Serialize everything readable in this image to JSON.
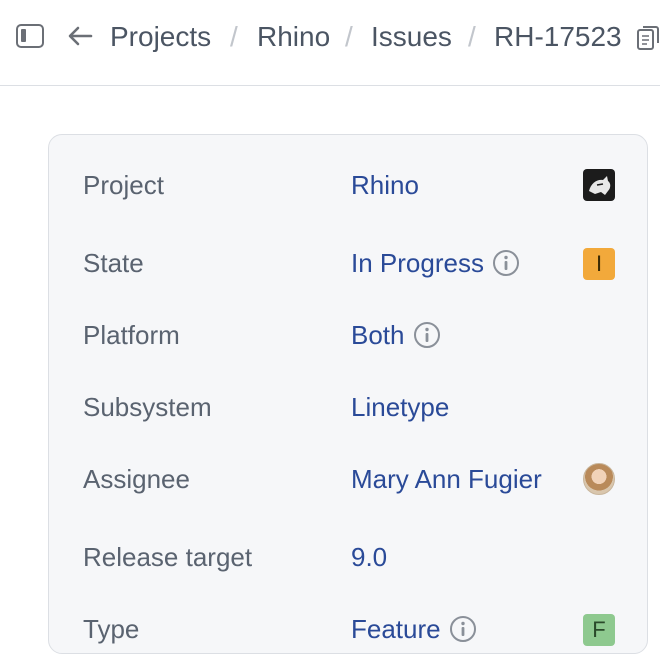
{
  "breadcrumb": {
    "items": [
      "Projects",
      "Rhino",
      "Issues",
      "RH-17523"
    ],
    "separator": "/"
  },
  "fields": [
    {
      "label": "Project",
      "value": "Rhino",
      "info": false,
      "badge": "logo"
    },
    {
      "label": "State",
      "value": "In Progress",
      "info": true,
      "badge": "I"
    },
    {
      "label": "Platform",
      "value": "Both",
      "info": true,
      "badge": ""
    },
    {
      "label": "Subsystem",
      "value": "Linetype",
      "info": false,
      "badge": ""
    },
    {
      "label": "Assignee",
      "value": "Mary Ann Fugier",
      "info": false,
      "badge": "avatar"
    },
    {
      "label": "Release target",
      "value": "9.0",
      "info": false,
      "badge": ""
    },
    {
      "label": "Type",
      "value": "Feature",
      "info": true,
      "badge": "F"
    }
  ],
  "colors": {
    "link": "#2a4a98",
    "label": "#5a6370",
    "state_badge": "#f2a93b",
    "type_badge": "#8ec98f",
    "card_bg": "#f6f7f9"
  },
  "icons": [
    "sidebar-toggle-icon",
    "back-arrow-icon",
    "copy-icon",
    "info-icon"
  ]
}
